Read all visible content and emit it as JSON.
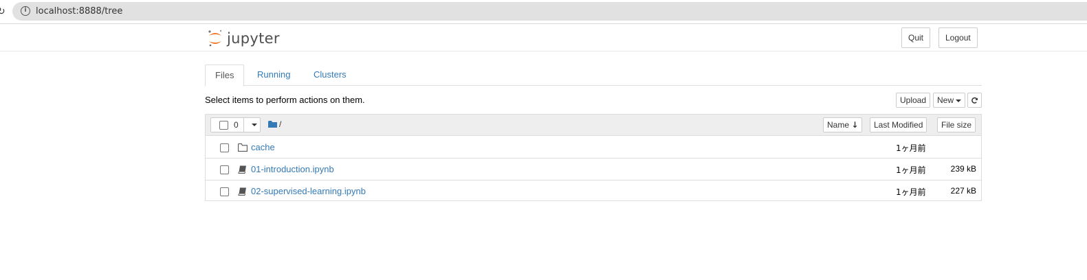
{
  "browser": {
    "url": "localhost:8888/tree",
    "reload_glyph": "↻"
  },
  "header": {
    "logo_text": "jupyter",
    "quit_label": "Quit",
    "logout_label": "Logout",
    "logo_color": "#f37726"
  },
  "tabs": [
    {
      "label": "Files",
      "active": true
    },
    {
      "label": "Running",
      "active": false
    },
    {
      "label": "Clusters",
      "active": false
    }
  ],
  "toolbar": {
    "hint": "Select items to perform actions on them.",
    "upload_label": "Upload",
    "new_label": "New",
    "refresh_icon": "refresh-icon"
  },
  "list_header": {
    "selected_count": "0",
    "path": "/",
    "sort_name_label": "Name",
    "sort_name_arrow": "↓",
    "sort_modified_label": "Last Modified",
    "sort_size_label": "File size"
  },
  "rows": [
    {
      "type": "folder",
      "name": "cache",
      "modified": "1ヶ月前",
      "size": ""
    },
    {
      "type": "notebook",
      "name": "01-introduction.ipynb",
      "modified": "1ヶ月前",
      "size": "239 kB"
    },
    {
      "type": "notebook",
      "name": "02-supervised-learning.ipynb",
      "modified": "1ヶ月前",
      "size": "227 kB"
    }
  ],
  "colors": {
    "link": "#337ab7",
    "brand": "#f37726"
  }
}
